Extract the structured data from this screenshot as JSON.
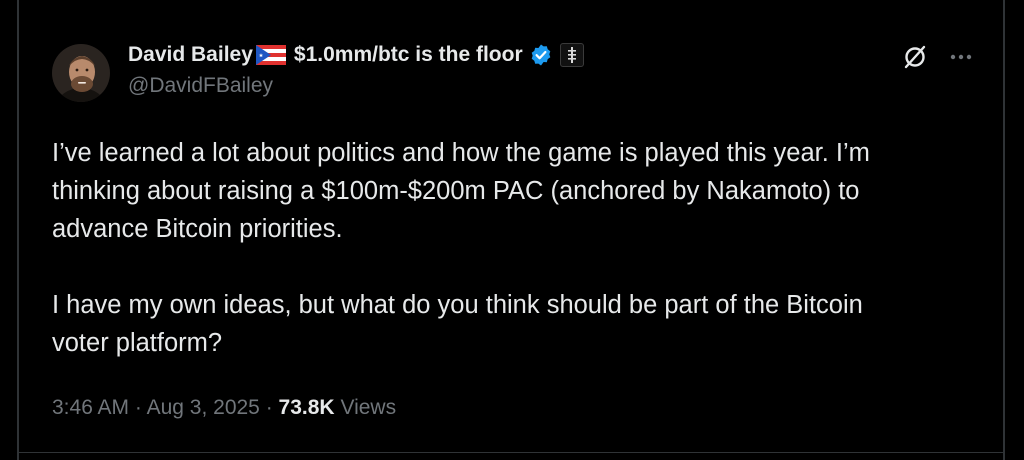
{
  "tweet": {
    "author": {
      "display_name": "David Bailey",
      "flag_icon": "puerto-rico-flag-icon",
      "display_name_suffix": "$1.0mm/btc is the floor",
      "verified_icon": "verified-badge-icon",
      "affiliation_icon": "affiliate-badge-icon",
      "handle": "@DavidFBailey"
    },
    "actions": {
      "grok_icon": "grok-icon",
      "more_icon": "more-horizontal-icon"
    },
    "paragraphs": [
      "I’ve learned a lot about politics and how the game is played this year. I’m\nthinking about raising a $100m-$200m PAC (anchored by Nakamoto) to\nadvance Bitcoin priorities.",
      "I have my own ideas, but what do you think should be part of the Bitcoin\nvoter platform?"
    ],
    "time": "3:46 AM",
    "separator": "·",
    "date": "Aug 3, 2025",
    "views_count": "73.8K",
    "views_label": "Views"
  },
  "colors": {
    "background": "#000000",
    "text_primary": "#e7e9ea",
    "text_secondary": "#71767b",
    "verified_blue": "#1d9bf0",
    "border": "#2f3336"
  }
}
